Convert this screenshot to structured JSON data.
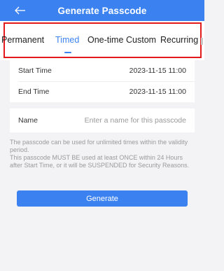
{
  "header": {
    "title": "Generate Passcode",
    "back_icon": "back-arrow-icon"
  },
  "tabs": [
    {
      "label": "Permanent",
      "active": false
    },
    {
      "label": "Timed",
      "active": true
    },
    {
      "label": "One-time",
      "active": false
    },
    {
      "label": "Custom",
      "active": false
    },
    {
      "label": "Recurring",
      "active": false
    }
  ],
  "time_card": {
    "start_label": "Start Time",
    "start_value": "2023-11-15 11:00",
    "end_label": "End Time",
    "end_value": "2023-11-15 11:00"
  },
  "name_card": {
    "label": "Name",
    "placeholder": "Enter a name for this passcode"
  },
  "note": {
    "line1": "The passcode can be used for unlimited times within the validity period.",
    "line2": "This passcode MUST BE used at least ONCE within 24 Hours after Start Time, or it will be SUSPENDED for Security Reasons."
  },
  "generate_label": "Generate",
  "colors": {
    "accent": "#3b82f0",
    "highlight_box": "#e11b1b"
  }
}
